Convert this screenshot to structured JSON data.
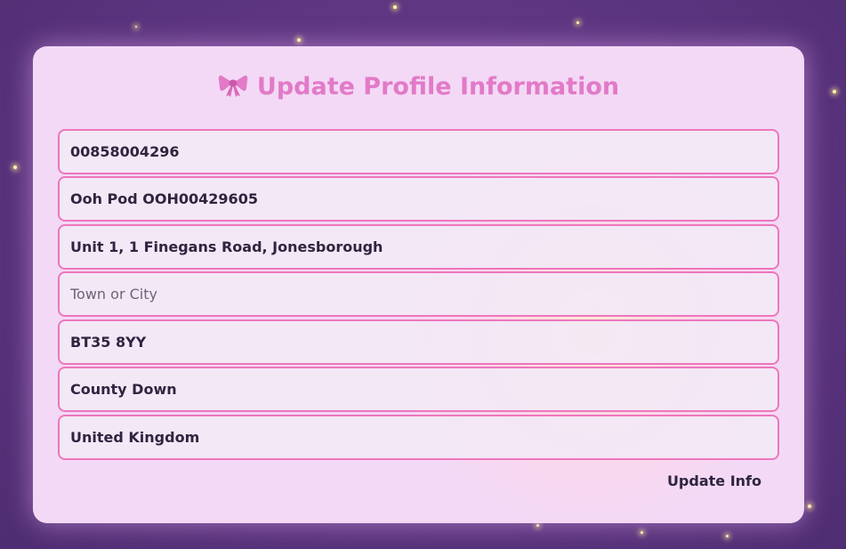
{
  "form": {
    "title": "Update Profile Information",
    "icon": "ribbon-bow-icon",
    "accent_color": "#e27ac7",
    "border_color": "#ee76bd",
    "fields": [
      {
        "name": "phone",
        "value": "00858004296",
        "placeholder": ""
      },
      {
        "name": "address-line-1",
        "value": "Ooh Pod OOH00429605",
        "placeholder": ""
      },
      {
        "name": "address-line-2",
        "value": "Unit 1, 1 Finegans Road, Jonesborough",
        "placeholder": ""
      },
      {
        "name": "town-city",
        "value": "",
        "placeholder": "Town or City"
      },
      {
        "name": "postcode",
        "value": "BT35 8YY",
        "placeholder": ""
      },
      {
        "name": "county",
        "value": "County Down",
        "placeholder": ""
      },
      {
        "name": "country",
        "value": "United Kingdom",
        "placeholder": ""
      }
    ],
    "submit_label": "Update Info"
  }
}
